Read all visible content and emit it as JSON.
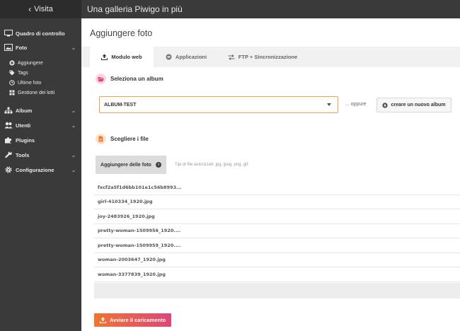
{
  "topbar": {
    "back_label": "Visita",
    "gallery_title": "Una galleria Piwigo in più"
  },
  "sidebar": {
    "items": [
      {
        "label": "Quadro di controllo",
        "icon": "monitor-icon"
      },
      {
        "label": "Foto",
        "icon": "image-icon",
        "expanded": true
      },
      {
        "label": "Album",
        "icon": "sitemap-icon"
      },
      {
        "label": "Utenti",
        "icon": "users-icon"
      },
      {
        "label": "Plugins",
        "icon": "puzzle-icon"
      },
      {
        "label": "Tools",
        "icon": "wrench-icon"
      },
      {
        "label": "Configurazione",
        "icon": "gear-icon"
      }
    ],
    "foto_subitems": [
      {
        "label": "Aggiungere",
        "icon": "plus-circle-icon"
      },
      {
        "label": "Tags",
        "icon": "tag-icon"
      },
      {
        "label": "Ultime foto",
        "icon": "clock-icon"
      },
      {
        "label": "Gestione dei lotti",
        "icon": "grid-icon"
      }
    ]
  },
  "main": {
    "page_title": "Aggiungere foto",
    "tabs": [
      {
        "label": "Modulo web",
        "icon": "upload-icon",
        "active": true
      },
      {
        "label": "Applicazioni",
        "icon": "puzzle-icon",
        "active": false
      },
      {
        "label": "FTP + Sincronizzazione",
        "icon": "transfer-icon",
        "active": false
      }
    ],
    "select_album": {
      "heading": "Seleziona un album",
      "selected_value": "ALBUM-TEST",
      "or_text": "... oppure",
      "create_button": "creare un nuovo album"
    },
    "choose_files": {
      "heading": "Scegliere i file",
      "add_button": "Aggiungere delle foto",
      "allowed_types": "Tipi di file autorizzati: jpg, jpeg, png, gif."
    },
    "files": [
      "fxcf2a5f1d6bb101e1c56b8993...",
      "girl-410334_1920.jpg",
      "joy-2483926_1920.jpg",
      "pretty-woman-1509956_1920....",
      "pretty-woman-1509959_1920....",
      "woman-2003647_1920.jpg",
      "woman-3377839_1920.jpg"
    ],
    "start_upload": "Avviare il caricamento"
  },
  "colors": {
    "sidebar_bg": "#3a3a3a",
    "accent_orange": "#f0752f",
    "accent_pink": "#e0457a",
    "select_border": "#f0a050"
  }
}
